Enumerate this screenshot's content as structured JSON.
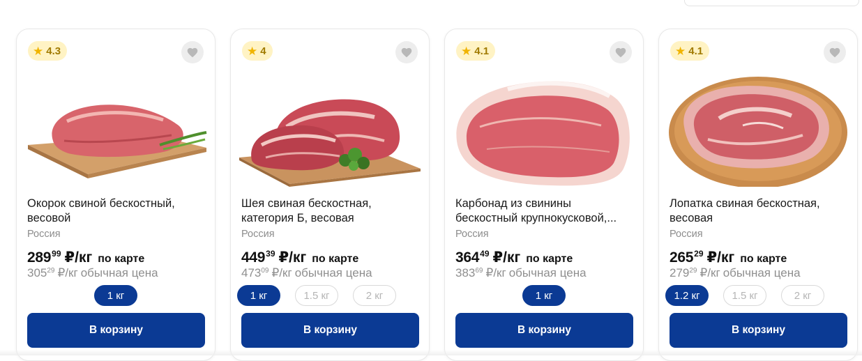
{
  "cart_label": "В корзину",
  "card_price_note": "по карте",
  "regular_price_note": "обычная цена",
  "price_unit": "₽/кг",
  "colors": {
    "accent": "#0b3a94",
    "rating_bg": "#fff3c4",
    "star": "#f0b400"
  },
  "products": [
    {
      "rating": "4.3",
      "title": "Окорок свиной бескостный, весовой",
      "origin": "Россия",
      "price_int": "289",
      "price_dec": "99",
      "reg_int": "305",
      "reg_dec": "29",
      "weights": [
        "1 кг"
      ],
      "selected_weight": "1 кг",
      "image": "pork-ham-on-board-image"
    },
    {
      "rating": "4",
      "title": "Шея свиная бескостная, категория Б, весовая",
      "origin": "Россия",
      "price_int": "449",
      "price_dec": "39",
      "reg_int": "473",
      "reg_dec": "09",
      "weights": [
        "1 кг",
        "1.5 кг",
        "2 кг"
      ],
      "selected_weight": "1 кг",
      "image": "pork-neck-on-board-image"
    },
    {
      "rating": "4.1",
      "title": "Карбонад из свинины бескостный крупнокусковой,...",
      "origin": "Россия",
      "price_int": "364",
      "price_dec": "49",
      "reg_int": "383",
      "reg_dec": "69",
      "weights": [
        "1 кг"
      ],
      "selected_weight": "1 кг",
      "image": "pork-loin-image"
    },
    {
      "rating": "4.1",
      "title": "Лопатка свиная бескостная, весовая",
      "origin": "Россия",
      "price_int": "265",
      "price_dec": "29",
      "reg_int": "279",
      "reg_dec": "29",
      "weights": [
        "1.2 кг",
        "1.5 кг",
        "2 кг"
      ],
      "selected_weight": "1.2 кг",
      "image": "pork-shoulder-on-round-board-image"
    }
  ]
}
